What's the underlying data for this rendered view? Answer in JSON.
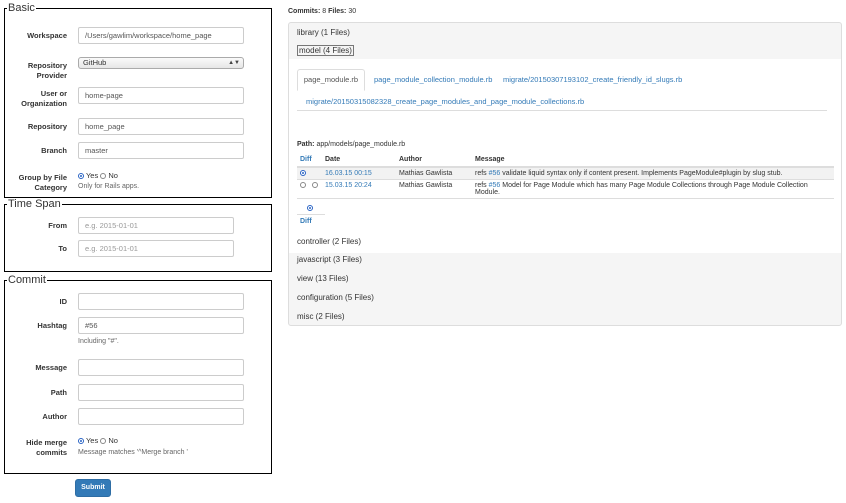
{
  "form": {
    "basic": {
      "legend": "Basic",
      "workspace_label": "Workspace",
      "workspace_value": "/Users/gawlim/workspace/home_page",
      "provider_label_1": "Repository",
      "provider_label_2": "Provider",
      "provider_value": "GitHub",
      "user_label_1": "User or",
      "user_label_2": "Organization",
      "user_value": "home-page",
      "repo_label": "Repository",
      "repo_value": "home_page",
      "branch_label": "Branch",
      "branch_value": "master",
      "group_label_1": "Group by File",
      "group_label_2": "Category",
      "yes": "Yes",
      "no": "No",
      "group_help": "Only for Rails apps."
    },
    "time": {
      "legend": "Time Span",
      "from_label": "From",
      "from_placeholder": "e.g. 2015-01-01",
      "to_label": "To",
      "to_placeholder": "e.g. 2015-01-01"
    },
    "commit": {
      "legend": "Commit",
      "id_label": "ID",
      "hashtag_label": "Hashtag",
      "hashtag_value": "#56",
      "hashtag_help": "Including \"#\".",
      "message_label": "Message",
      "path_label": "Path",
      "author_label": "Author",
      "hide_label_1": "Hide merge",
      "hide_label_2": "commits",
      "yes": "Yes",
      "no": "No",
      "hide_help": "Message matches '^Merge branch '"
    },
    "submit_label": "Submit"
  },
  "summary": {
    "commits_label": "Commits:",
    "commits_count": "8",
    "files_label": "Files:",
    "files_count": "30"
  },
  "accordion": {
    "library": "library (1 Files)",
    "model": "model (4 Files)",
    "controller": "controller (2 Files)",
    "javascript": "javascript (3 Files)",
    "view": "view (13 Files)",
    "configuration": "configuration (5 Files)",
    "misc": "misc (2 Files)"
  },
  "tabs": [
    "page_module.rb",
    "page_module_collection_module.rb",
    "migrate/20150307193102_create_friendly_id_slugs.rb",
    "migrate/20150315082328_create_page_modules_and_page_module_collections.rb"
  ],
  "path": {
    "label": "Path:",
    "value": "app/models/page_module.rb"
  },
  "table": {
    "headers": [
      "Diff",
      "Date",
      "Author",
      "Message"
    ],
    "rows": [
      {
        "date": "16.03.15 00:15",
        "author": "Mathias Gawlista",
        "msg_pre": "refs ",
        "msg_ref": "#56",
        "msg_post": " validate liquid syntax only if content present. Implements PageModule#plugin by slug stub."
      },
      {
        "date": "15.03.15 20:24",
        "author": "Mathias Gawlista",
        "msg_pre": "refs ",
        "msg_ref": "#56",
        "msg_post": " Model for Page Module which has many Page Module Collections through Page Module Collection Module."
      }
    ],
    "diff_button": "Diff"
  }
}
